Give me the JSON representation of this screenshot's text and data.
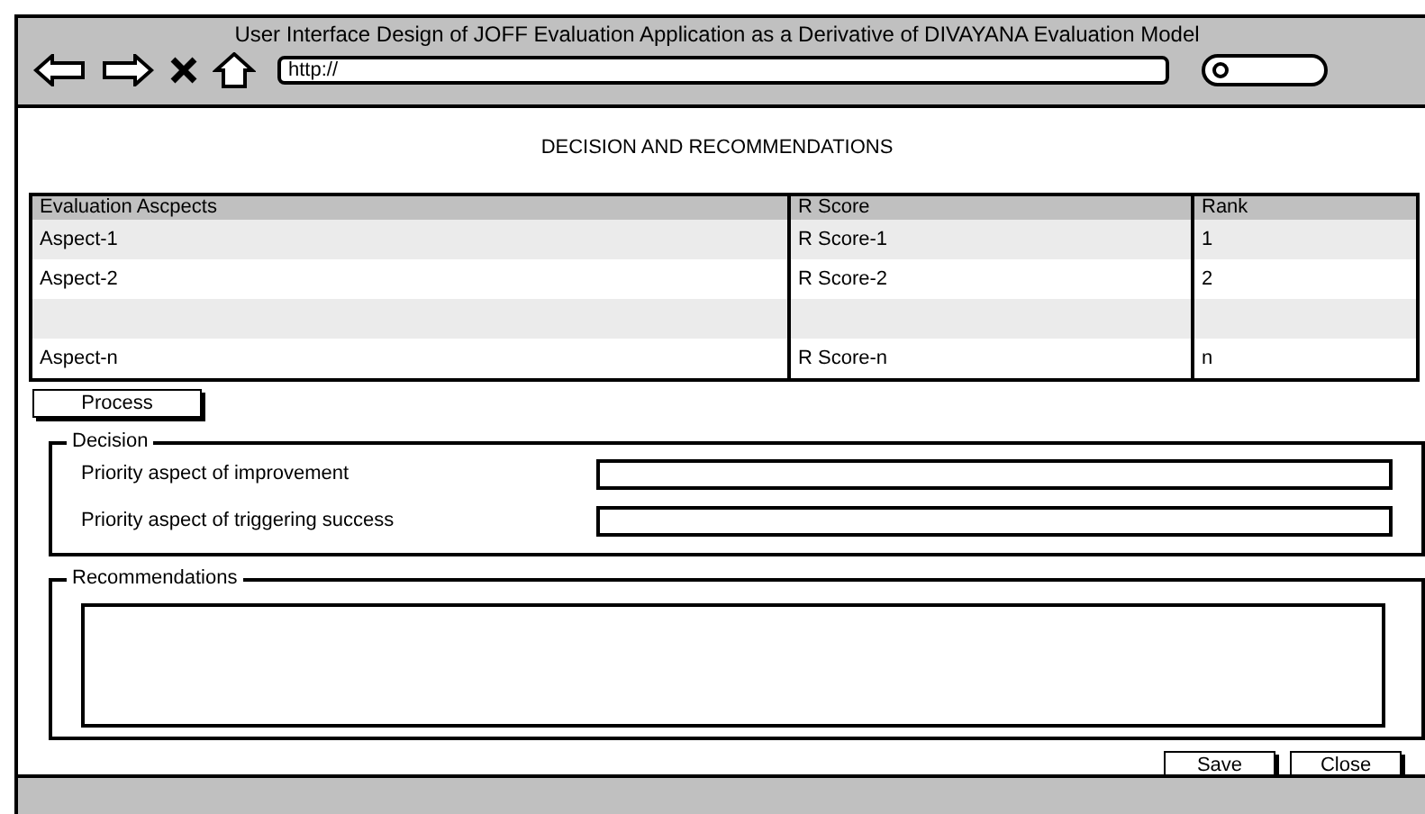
{
  "window": {
    "title": "User Interface Design of JOFF Evaluation Application as a Derivative of DIVAYANA Evaluation Model"
  },
  "address_bar": {
    "value": "http://"
  },
  "page_title": "DECISION AND RECOMMENDATIONS",
  "table": {
    "columns": [
      "Evaluation Ascpects",
      "R Score",
      "Rank"
    ],
    "rows": [
      [
        "Aspect-1",
        "R Score-1",
        "1"
      ],
      [
        "Aspect-2",
        "R Score-2",
        "2"
      ],
      [
        "",
        "",
        ""
      ],
      [
        "Aspect-n",
        "R Score-n",
        "n"
      ]
    ]
  },
  "process_button": "Process",
  "decision": {
    "legend": "Decision",
    "fields": [
      {
        "label": "Priority aspect of improvement"
      },
      {
        "label": "Priority aspect of triggering success"
      }
    ]
  },
  "recommendations": {
    "legend": "Recommendations"
  },
  "buttons": [
    "Save",
    "Close"
  ]
}
